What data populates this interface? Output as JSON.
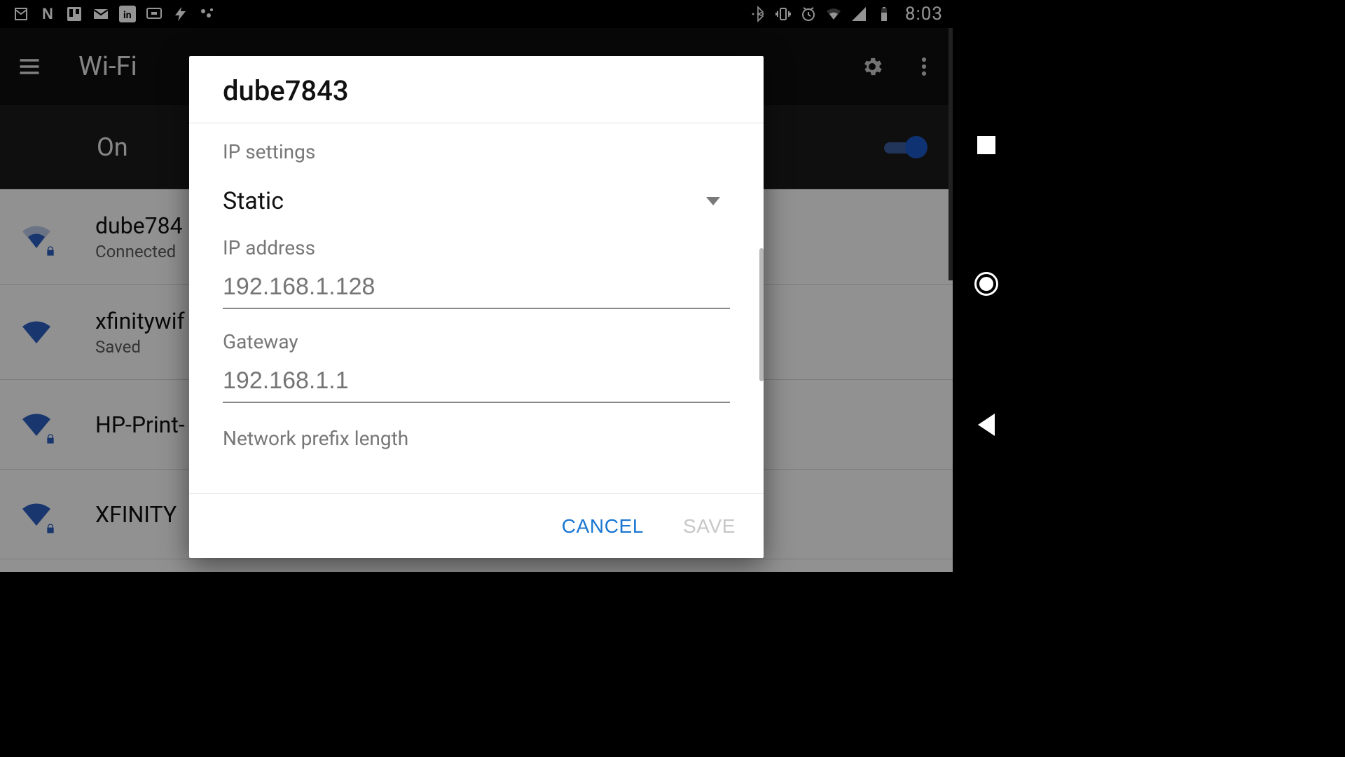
{
  "statusbar": {
    "clock": "8:03",
    "left_icons": [
      "gmail-icon",
      "netflix-icon",
      "trello-icon",
      "mail-icon",
      "linkedin-icon",
      "cast-icon",
      "flash-icon",
      "more-icon"
    ],
    "right_icons": [
      "bluetooth-icon",
      "vibrate-icon",
      "alarm-icon",
      "wifi-status-icon",
      "cell-signal-icon",
      "battery-icon"
    ]
  },
  "toolbar": {
    "title": "Wi-Fi",
    "icons": {
      "menu": "hamburger-icon",
      "settings": "gear-icon",
      "overflow": "kebab-icon"
    }
  },
  "wifi_toggle": {
    "label": "On",
    "state": true
  },
  "networks": [
    {
      "ssid": "dube784",
      "subtitle": "Connected",
      "locked": true,
      "strength": "medium"
    },
    {
      "ssid": "xfinitywif",
      "subtitle": "Saved",
      "locked": false,
      "strength": "full"
    },
    {
      "ssid": "HP-Print-",
      "subtitle": "",
      "locked": true,
      "strength": "full"
    },
    {
      "ssid": "XFINITY",
      "subtitle": "",
      "locked": true,
      "strength": "full"
    }
  ],
  "dialog": {
    "title": "dube7843",
    "ip_settings_label": "IP settings",
    "ip_settings_value": "Static",
    "fields": {
      "ip_address": {
        "label": "IP address",
        "placeholder": "192.168.1.128"
      },
      "gateway": {
        "label": "Gateway",
        "placeholder": "192.168.1.1"
      },
      "prefix": {
        "label": "Network prefix length"
      }
    },
    "actions": {
      "cancel": "CANCEL",
      "save": "SAVE"
    }
  },
  "navbar": {
    "recents": "square-icon",
    "home": "circle-icon",
    "back": "triangle-back-icon"
  }
}
